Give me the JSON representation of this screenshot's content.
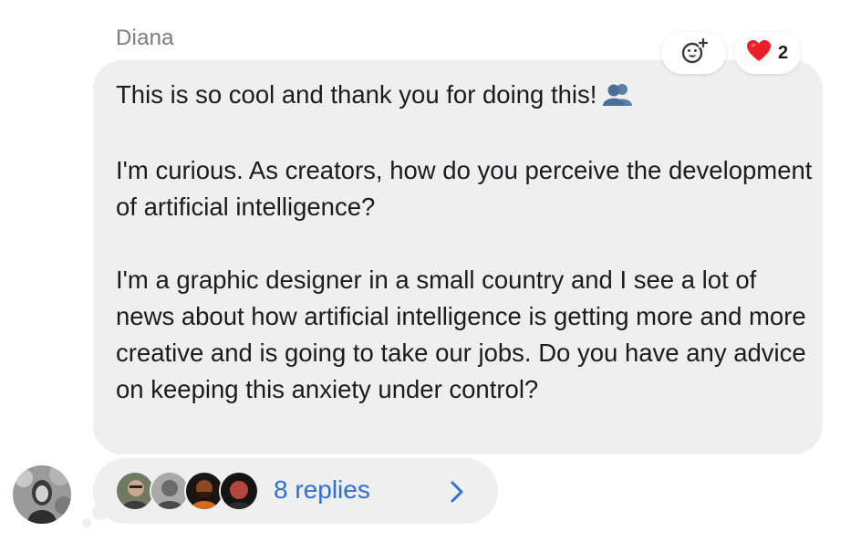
{
  "message": {
    "sender": "Diana",
    "paragraphs": [
      "This is so cool and thank you for doing this!",
      "I'm curious. As creators, how do you perceive the development of artificial intelligence?",
      "I'm a graphic designer in a small country and I see a lot of news about how artificial intelligence is getting more and more creative and is going to take our jobs. Do you have any advice on keeping this anxiety under control?"
    ],
    "inline_emoji": "busts-in-silhouette-icon"
  },
  "reactions": {
    "add_icon": "add-reaction-icon",
    "heart_icon": "red-heart-icon",
    "heart_count": "2"
  },
  "thread": {
    "replies_label": "8 replies",
    "reply_avatar_count": 4,
    "chevron_icon": "chevron-right-icon"
  },
  "colors": {
    "bubble": "#efeff0",
    "text": "#1c1c1e",
    "sender": "#7b7b80",
    "link": "#2f6fd6",
    "heart": "#e8202a"
  }
}
